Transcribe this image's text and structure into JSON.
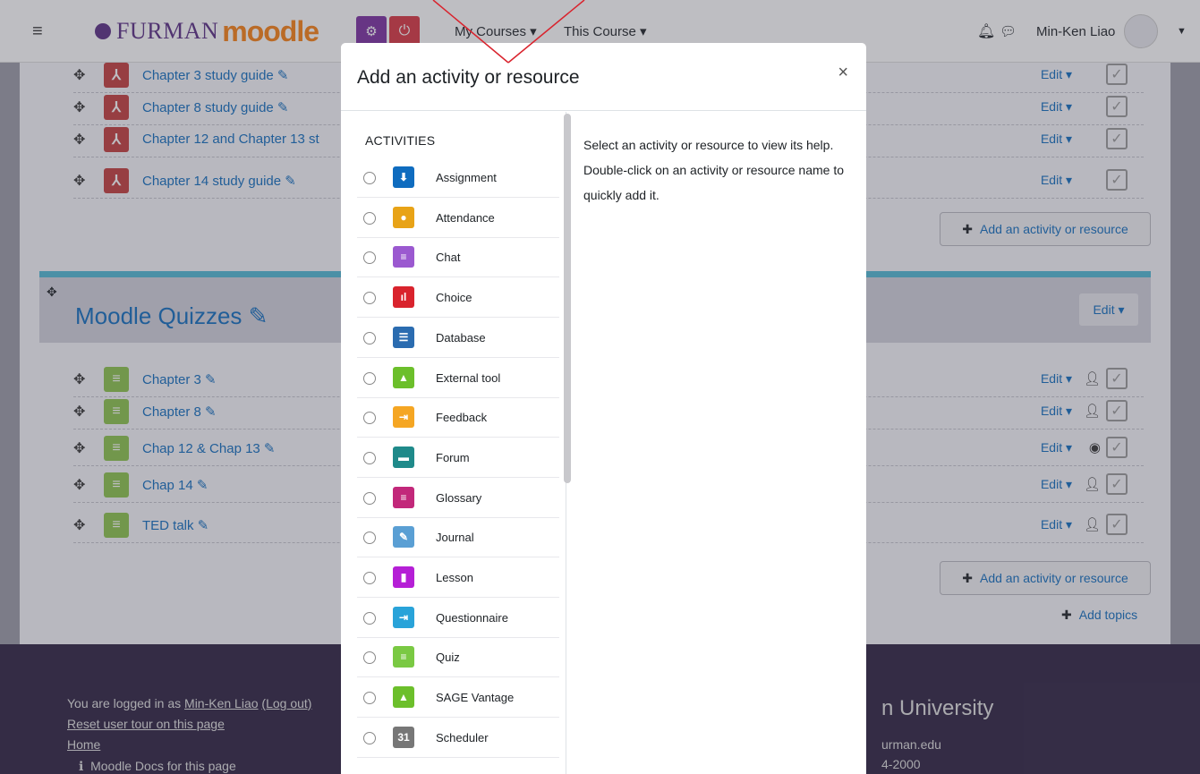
{
  "navbar": {
    "logo_text": "FURMAN",
    "logo_product": "moodle",
    "my_courses": "My Courses ▾",
    "this_course": "This Course ▾",
    "user_name": "Min-Ken Liao"
  },
  "course": {
    "rows_top": [
      {
        "title": "Chapter 3 study guide ✎",
        "edit": "Edit ▾"
      },
      {
        "title": "Chapter 8 study guide ✎",
        "edit": "Edit ▾"
      },
      {
        "title": "Chapter 12 and Chapter 13 st",
        "edit": "Edit ▾"
      },
      {
        "title": "Chapter 14 study guide ✎",
        "edit": "Edit ▾"
      }
    ],
    "add_activity_label": "Add an activity or resource",
    "section_title": "Moodle Quizzes ✎",
    "section_edit": "Edit ▾",
    "quiz_rows": [
      {
        "title": "Chapter 3 ✎",
        "edit": "Edit ▾"
      },
      {
        "title": "Chapter 8 ✎",
        "edit": "Edit ▾"
      },
      {
        "title": "Chap 12 & Chap 13 ✎",
        "edit": "Edit ▾"
      },
      {
        "title": "Chap 14 ✎",
        "edit": "Edit ▾"
      },
      {
        "title": "TED talk ✎",
        "edit": "Edit ▾"
      }
    ],
    "add_topics": "Add topics"
  },
  "footer": {
    "logged_in_prefix": "You are logged in as ",
    "logged_in_user": "Min-Ken Liao",
    "logout": "(Log out)",
    "reset_tour": "Reset user tour on this page",
    "home": "Home",
    "docs": "Moodle Docs for this page",
    "university": "n University",
    "email": "urman.edu",
    "phone": "4-2000"
  },
  "modal": {
    "title": "Add an activity or resource",
    "close": "×",
    "section_heading": "ACTIVITIES",
    "help_text": "Select an activity or resource to view its help. Double-click on an activity or resource name to quickly add it.",
    "options": [
      {
        "name": "Assignment",
        "icon": "assignment-icon",
        "color": "#0f6cbf"
      },
      {
        "name": "Attendance",
        "icon": "attendance-icon",
        "color": "#e8a317"
      },
      {
        "name": "Chat",
        "icon": "chat-icon",
        "color": "#9b59d0"
      },
      {
        "name": "Choice",
        "icon": "choice-icon",
        "color": "#d9232d"
      },
      {
        "name": "Database",
        "icon": "database-icon",
        "color": "#2b6cb0"
      },
      {
        "name": "External tool",
        "icon": "external-tool-icon",
        "color": "#6cbf2b"
      },
      {
        "name": "Feedback",
        "icon": "feedback-icon",
        "color": "#f5a623"
      },
      {
        "name": "Forum",
        "icon": "forum-icon",
        "color": "#1f8a8a"
      },
      {
        "name": "Glossary",
        "icon": "glossary-icon",
        "color": "#c2287a"
      },
      {
        "name": "Journal",
        "icon": "journal-icon",
        "color": "#5a9fd4"
      },
      {
        "name": "Lesson",
        "icon": "lesson-icon",
        "color": "#b51fd6"
      },
      {
        "name": "Questionnaire",
        "icon": "questionnaire-icon",
        "color": "#29a3d9"
      },
      {
        "name": "Quiz",
        "icon": "quiz-icon",
        "color": "#7ac943"
      },
      {
        "name": "SAGE Vantage",
        "icon": "sage-vantage-icon",
        "color": "#6cbf2b"
      },
      {
        "name": "Scheduler",
        "icon": "scheduler-icon",
        "color": "#777777"
      }
    ]
  }
}
